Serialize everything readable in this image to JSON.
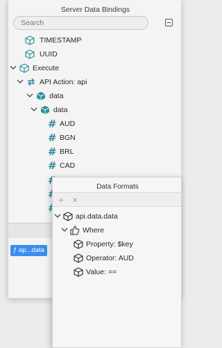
{
  "bindings": {
    "title": "Server Data Bindings",
    "search_placeholder": "Search",
    "collapse_button": "Collapse All",
    "tree": [
      {
        "label": "TIMESTAMP",
        "icon": "cube-outline-icon"
      },
      {
        "label": "UUID",
        "icon": "cube-outline-icon"
      },
      {
        "label": "Execute",
        "icon": "cube-outline-icon"
      },
      {
        "label": "API Action: api",
        "icon": "sync-arrows-icon"
      },
      {
        "label": "data",
        "icon": "cube-filled-icon"
      },
      {
        "label": "data",
        "icon": "cube-filled-icon"
      },
      {
        "label": "AUD",
        "icon": "hash-icon"
      },
      {
        "label": "BGN",
        "icon": "hash-icon"
      },
      {
        "label": "BRL",
        "icon": "hash-icon"
      },
      {
        "label": "CAD",
        "icon": "hash-icon"
      }
    ],
    "formula_chip": "ƒ ap...data"
  },
  "formats": {
    "title": "Data Formats",
    "add_label": "+",
    "remove_label": "×",
    "tree": [
      {
        "label": "api.data.data",
        "icon": "cube-outline-icon"
      },
      {
        "label": "Where",
        "icon": "thumbs-up-icon"
      },
      {
        "label": "Property: $key",
        "icon": "cube-outline-icon"
      },
      {
        "label": "Operator: AUD",
        "icon": "cube-outline-icon"
      },
      {
        "label": "Value: ==",
        "icon": "cube-outline-icon"
      }
    ]
  },
  "colors": {
    "accent": "#2d8f9c",
    "selection": "#3b8ef0"
  }
}
